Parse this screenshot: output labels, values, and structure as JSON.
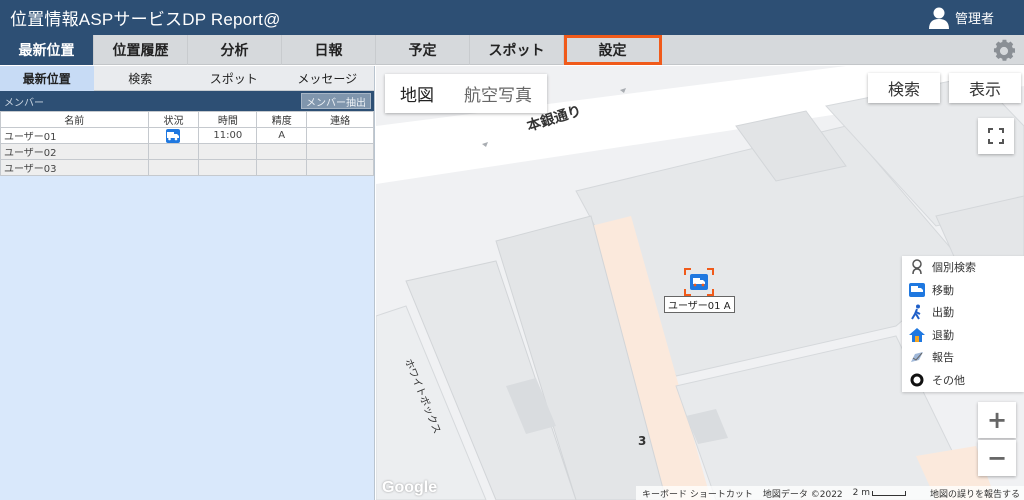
{
  "header": {
    "title": "位置情報ASPサービスDP Report@",
    "user": "管理者"
  },
  "nav": {
    "tabs": [
      {
        "label": "最新位置"
      },
      {
        "label": "位置履歴"
      },
      {
        "label": "分析"
      },
      {
        "label": "日報"
      },
      {
        "label": "予定"
      },
      {
        "label": "スポット"
      },
      {
        "label": "設定"
      }
    ],
    "active_index": 0,
    "highlighted_index": 6
  },
  "subtabs": [
    {
      "label": "最新位置"
    },
    {
      "label": "検索"
    },
    {
      "label": "スポット"
    },
    {
      "label": "メッセージ"
    }
  ],
  "members": {
    "label": "メンバー",
    "extract_button": "メンバー抽出",
    "columns": [
      "名前",
      "状況",
      "時間",
      "精度",
      "連絡"
    ],
    "rows": [
      {
        "name": "ユーザー01",
        "status": "moving",
        "time": "11:00",
        "accuracy": "A",
        "contact": ""
      },
      {
        "name": "ユーザー02",
        "status": "",
        "time": "",
        "accuracy": "",
        "contact": ""
      },
      {
        "name": "ユーザー03",
        "status": "",
        "time": "",
        "accuracy": "",
        "contact": ""
      }
    ]
  },
  "map": {
    "type_map": "地図",
    "type_satellite": "航空写真",
    "search_button": "検索",
    "display_button": "表示",
    "street_name": "本銀通り",
    "building_label": "ホワイトボックス",
    "marker_label": "ユーザー01 A",
    "block_number": "3",
    "google": "Google",
    "footer": {
      "shortcuts": "キーボード ショートカット",
      "map_data": "地図データ ©2022",
      "scale": "2 m",
      "report": "地図の誤りを報告する"
    },
    "zoom_in": "+",
    "zoom_out": "−"
  },
  "legend": [
    {
      "icon": "person-search-icon",
      "label": "個別検索"
    },
    {
      "icon": "truck-icon",
      "label": "移動"
    },
    {
      "icon": "walking-icon",
      "label": "出勤"
    },
    {
      "icon": "home-icon",
      "label": "退勤"
    },
    {
      "icon": "report-icon",
      "label": "報告"
    },
    {
      "icon": "ring-icon",
      "label": "その他"
    }
  ],
  "colors": {
    "header": "#2d4f74",
    "highlight": "#f05a1a",
    "status_blue": "#1f78e0",
    "panel_bg": "#d9e8fb"
  }
}
